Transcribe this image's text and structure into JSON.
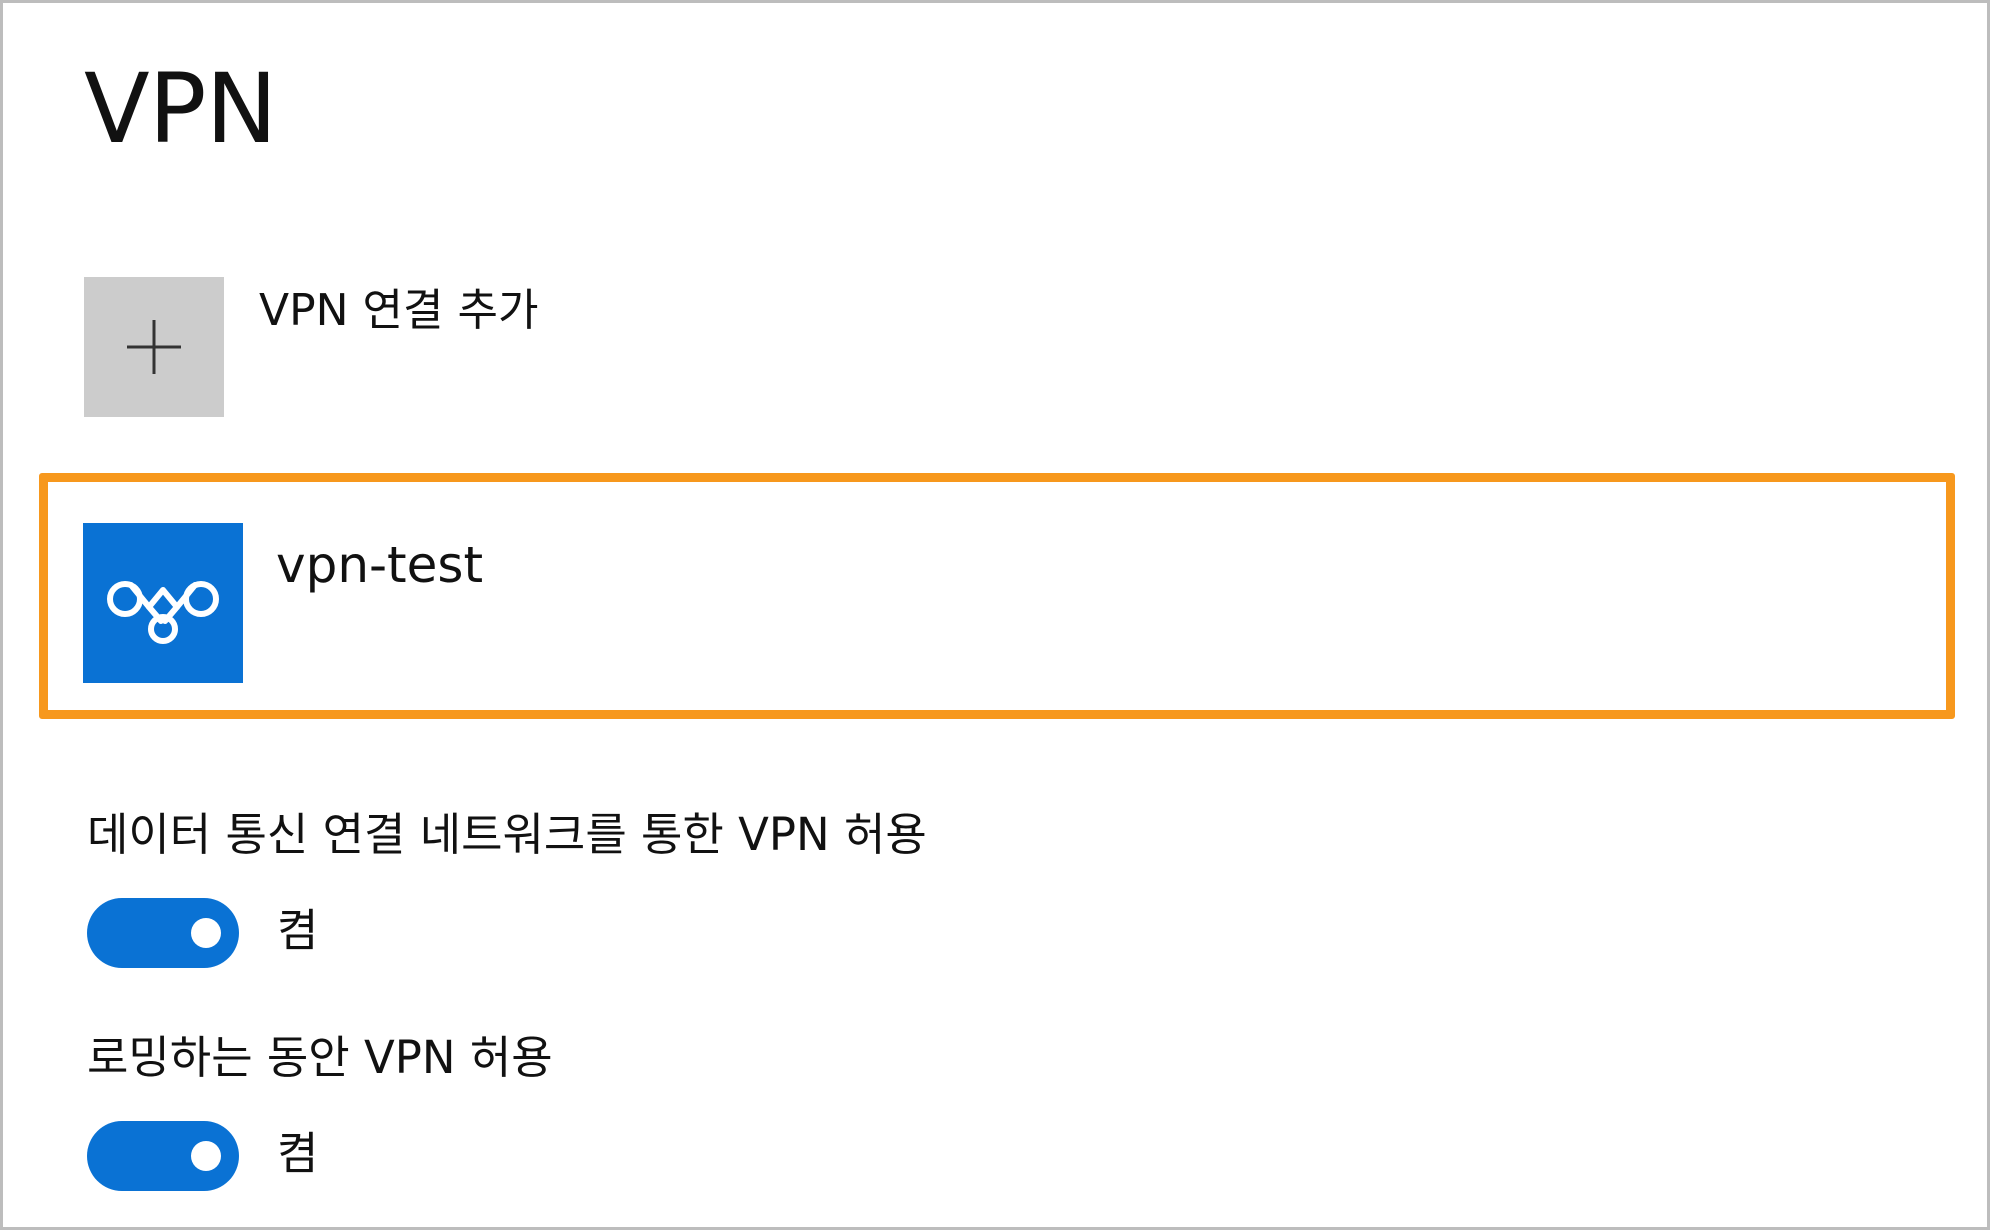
{
  "page": {
    "title": "VPN"
  },
  "add_connection": {
    "label": "VPN 연결 추가",
    "icon": "plus-icon"
  },
  "vpn_connections": [
    {
      "name": "vpn-test",
      "icon": "vpn-logo-icon",
      "selected": true
    }
  ],
  "settings": [
    {
      "label": "데이터 통신 연결 네트워크를 통한 VPN 허용",
      "toggle_state": "켬",
      "on": true
    },
    {
      "label": "로밍하는 동안 VPN 허용",
      "toggle_state": "켬",
      "on": true
    }
  ],
  "colors": {
    "accent": "#0a72d4",
    "highlight_border": "#f7981d",
    "add_tile": "#cccccc",
    "frame_border": "#bdbdbd"
  }
}
